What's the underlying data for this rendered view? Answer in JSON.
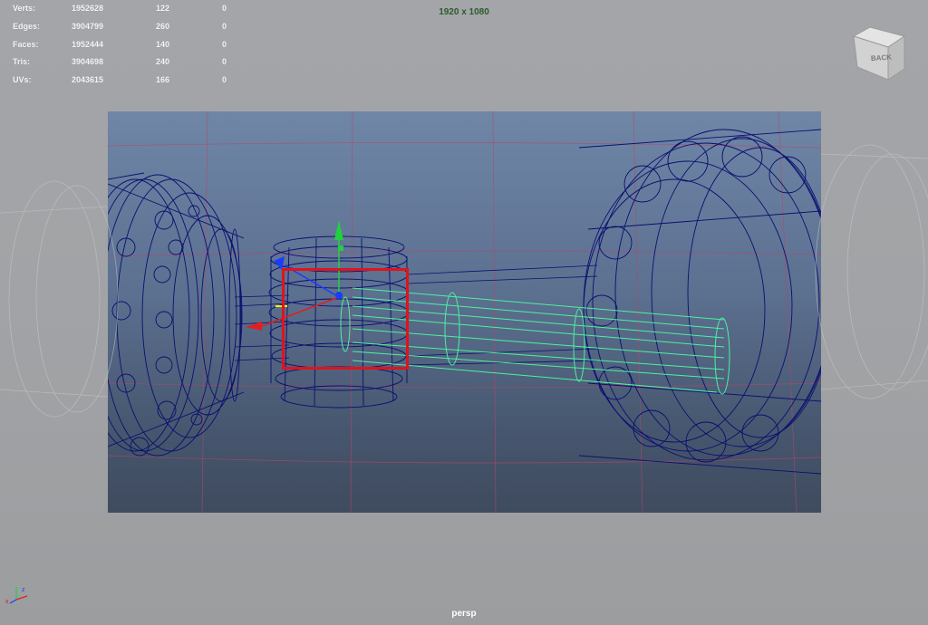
{
  "hud": {
    "rows": [
      {
        "label": "Verts:",
        "total": "1952628",
        "selected": "122",
        "component": "0"
      },
      {
        "label": "Edges:",
        "total": "3904799",
        "selected": "260",
        "component": "0"
      },
      {
        "label": "Faces:",
        "total": "1952444",
        "selected": "140",
        "component": "0"
      },
      {
        "label": "Tris:",
        "total": "3904698",
        "selected": "240",
        "component": "0"
      },
      {
        "label": "UVs:",
        "total": "2043615",
        "selected": "166",
        "component": "0"
      }
    ]
  },
  "resolution_gate": "1920 x 1080",
  "camera_name": "persp",
  "viewcube": {
    "face_label": "BACK"
  },
  "axis_indicator": {
    "x_label": "x",
    "z_label": "z"
  },
  "colors": {
    "wireframe": "#0b0f6e",
    "selected_wire": "#4cf2a0",
    "selection_highlight": "#e0141b",
    "grid": "#b4476b",
    "manipulator_x": "#e02020",
    "manipulator_y": "#20d040",
    "manipulator_z": "#1a3cff"
  },
  "icons": {
    "viewcube": "view-cube-icon",
    "axis": "axis-triad-icon",
    "move_tool": "move-manipulator-icon"
  }
}
